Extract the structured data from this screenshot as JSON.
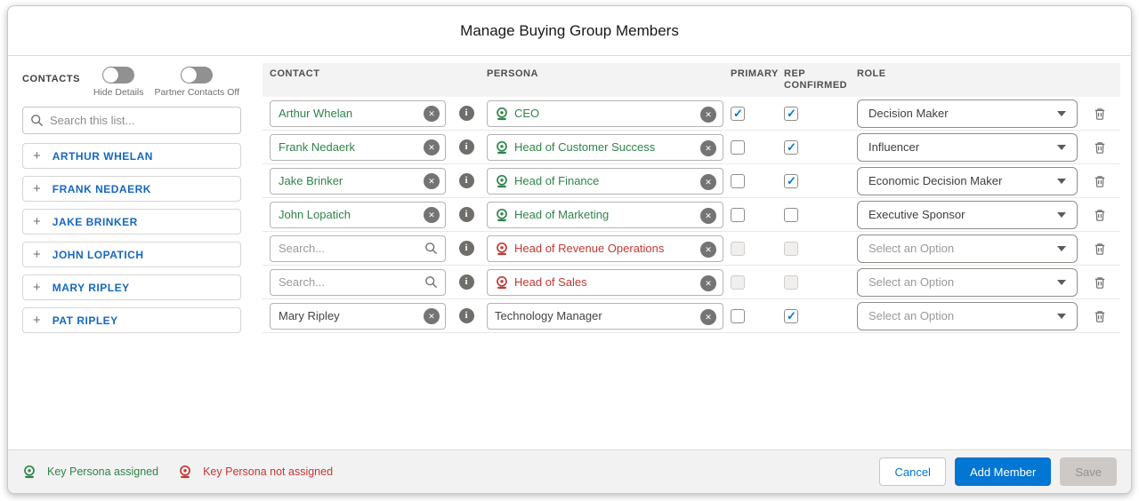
{
  "dialog": {
    "title": "Manage Buying Group Members"
  },
  "icons": {
    "clear": "✕",
    "info": "i",
    "plus": "+"
  },
  "sidebar": {
    "title": "CONTACTS",
    "toggles": [
      {
        "label": "Hide Details",
        "state": "off"
      },
      {
        "label": "Partner Contacts Off",
        "state": "off"
      }
    ],
    "search_placeholder": "Search this list...",
    "contacts": [
      "ARTHUR WHELAN",
      "FRANK NEDAERK",
      "JAKE BRINKER",
      "JOHN LOPATICH",
      "MARY RIPLEY",
      "PAT RIPLEY"
    ]
  },
  "table": {
    "headers": [
      "CONTACT",
      "PERSONA",
      "PRIMARY",
      "REP CONFIRMED",
      "ROLE"
    ],
    "contact_search_placeholder": "Search...",
    "role_placeholder": "Select an Option",
    "rows": [
      {
        "contact": "Arthur Whelan",
        "contact_type": "filled",
        "contact_color": "green",
        "persona": "CEO",
        "persona_state": "assigned",
        "primary_checked": true,
        "primary_disabled": false,
        "rep_checked": true,
        "rep_disabled": false,
        "role": "Decision Maker",
        "role_selected": true
      },
      {
        "contact": "Frank Nedaerk",
        "contact_type": "filled",
        "contact_color": "green",
        "persona": "Head of Customer Success",
        "persona_state": "assigned",
        "primary_checked": false,
        "primary_disabled": false,
        "rep_checked": true,
        "rep_disabled": false,
        "role": "Influencer",
        "role_selected": true
      },
      {
        "contact": "Jake Brinker",
        "contact_type": "filled",
        "contact_color": "green",
        "persona": "Head of Finance",
        "persona_state": "assigned",
        "primary_checked": false,
        "primary_disabled": false,
        "rep_checked": true,
        "rep_disabled": false,
        "role": "Economic Decision Maker",
        "role_selected": true
      },
      {
        "contact": "John Lopatich",
        "contact_type": "filled",
        "contact_color": "green",
        "persona": "Head of Marketing",
        "persona_state": "assigned",
        "primary_checked": false,
        "primary_disabled": false,
        "rep_checked": false,
        "rep_disabled": false,
        "role": "Executive Sponsor",
        "role_selected": true
      },
      {
        "contact": "",
        "contact_type": "search",
        "contact_color": "none",
        "persona": "Head of Revenue Operations",
        "persona_state": "not-assigned",
        "primary_checked": false,
        "primary_disabled": true,
        "rep_checked": false,
        "rep_disabled": true,
        "role": "",
        "role_selected": false
      },
      {
        "contact": "",
        "contact_type": "search",
        "contact_color": "none",
        "persona": "Head of Sales",
        "persona_state": "not-assigned",
        "primary_checked": false,
        "primary_disabled": true,
        "rep_checked": false,
        "rep_disabled": true,
        "role": "",
        "role_selected": false
      },
      {
        "contact": "Mary Ripley",
        "contact_type": "filled",
        "contact_color": "black",
        "persona": "Technology Manager",
        "persona_state": "none",
        "primary_checked": false,
        "primary_disabled": false,
        "rep_checked": true,
        "rep_disabled": false,
        "role": "",
        "role_selected": false
      }
    ]
  },
  "footer": {
    "legend": [
      {
        "label": "Key Persona assigned",
        "color": "#2e844a"
      },
      {
        "label": "Key Persona not assigned",
        "color": "#c23934"
      }
    ],
    "buttons": {
      "cancel": "Cancel",
      "add_member": "Add Member",
      "save": "Save"
    }
  },
  "colors": {
    "green": "#2e844a",
    "red": "#c23934",
    "accent_blue": "#0176d3",
    "name_blue": "#1767c0"
  }
}
